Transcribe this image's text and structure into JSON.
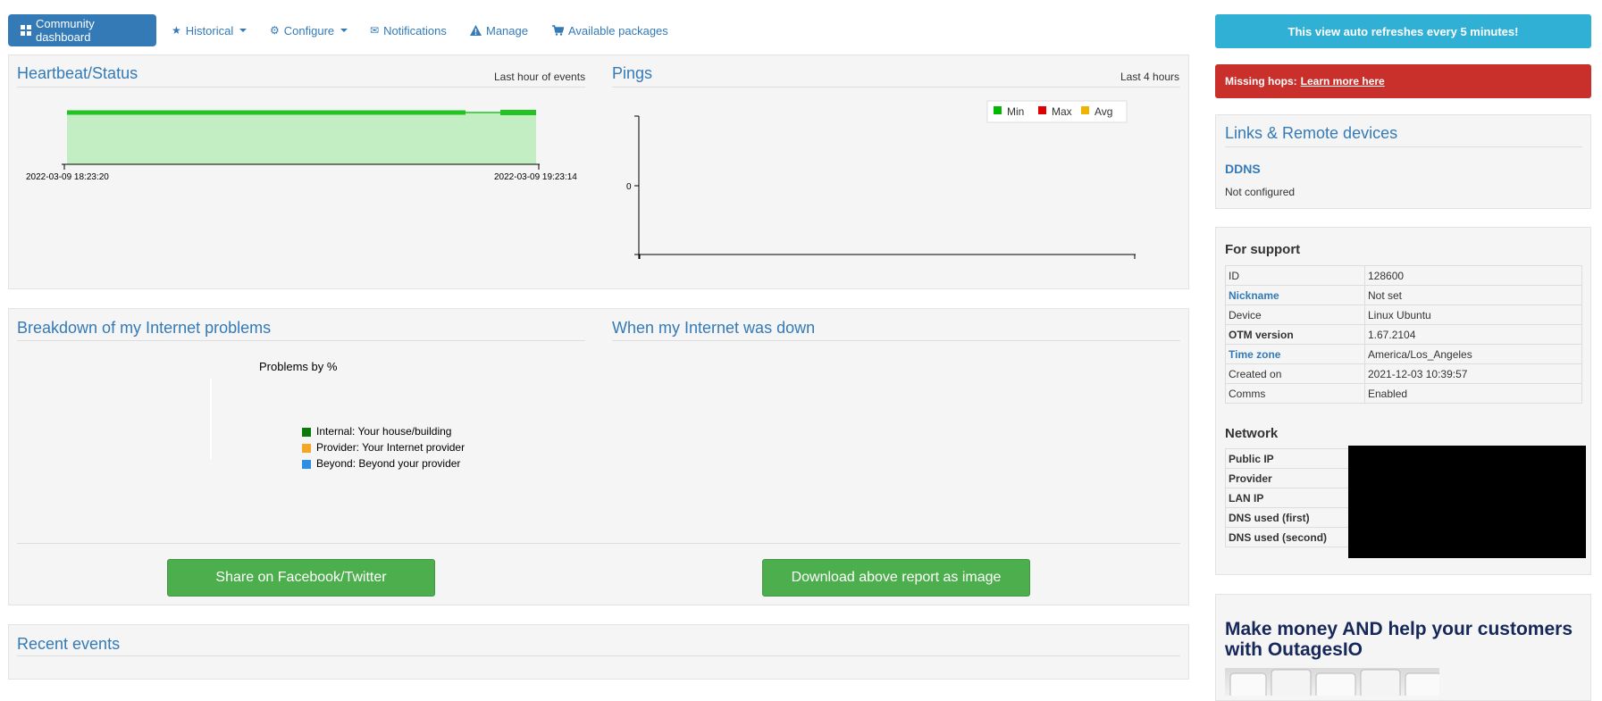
{
  "nav": {
    "items": [
      {
        "label": "Community dashboard",
        "icon": "dashboard-grid-icon",
        "active": true
      },
      {
        "label": "Historical",
        "icon": "star-icon",
        "dropdown": true
      },
      {
        "label": "Configure",
        "icon": "gear-icon",
        "dropdown": true
      },
      {
        "label": "Notifications",
        "icon": "envelope-icon"
      },
      {
        "label": "Manage",
        "icon": "warning-icon"
      },
      {
        "label": "Available packages",
        "icon": "cart-icon"
      }
    ]
  },
  "heartbeat": {
    "title": "Heartbeat/Status",
    "subtitle": "Last hour of events",
    "chart_data": {
      "type": "area",
      "x_start": "2022-03-09 18:23:20",
      "x_end": "2022-03-09 19:23:14",
      "tick_labels": [
        "2022-03-09 18:23:20",
        "2022-03-09 19:23:14"
      ],
      "color": "#22c322",
      "fill": "#c3edc3"
    }
  },
  "pings": {
    "title": "Pings",
    "subtitle": "Last 4 hours",
    "chart_data": {
      "type": "line",
      "y_ticks": [
        "0"
      ],
      "series": [
        {
          "name": "Min",
          "color": "#00b800",
          "values": []
        },
        {
          "name": "Max",
          "color": "#e00000",
          "values": []
        },
        {
          "name": "Avg",
          "color": "#f0b400",
          "values": []
        }
      ],
      "legend": "top-right"
    }
  },
  "breakdown": {
    "title": "Breakdown of my Internet problems",
    "chart_data": {
      "type": "pie",
      "title": "Problems by %",
      "legend": [
        {
          "name": "Internal: Your house/building",
          "color": "#0a7a0a"
        },
        {
          "name": "Provider: Your Internet provider",
          "color": "#f5a623"
        },
        {
          "name": "Beyond: Beyond your provider",
          "color": "#2b8fe6"
        }
      ],
      "values": []
    }
  },
  "down": {
    "title": "When my Internet was down"
  },
  "buttons": {
    "share": "Share on Facebook/Twitter",
    "download": "Download above report as image"
  },
  "recent": {
    "title": "Recent events"
  },
  "right": {
    "refresh": "This view auto refreshes every 5 minutes!",
    "missing_label": "Missing hops:",
    "missing_link": "Learn more here",
    "links_title": "Links & Remote devices",
    "ddns_title": "DDNS",
    "ddns_status": "Not configured",
    "support_title": "For support",
    "support_rows": [
      {
        "key": "ID",
        "value": "128600",
        "link": false
      },
      {
        "key": "Nickname",
        "value": "Not set",
        "link": true
      },
      {
        "key": "Device",
        "value": "Linux Ubuntu",
        "link": false
      },
      {
        "key": "OTM version",
        "value": "1.67.2104",
        "link": false,
        "bold": true
      },
      {
        "key": "Time zone",
        "value": "America/Los_Angeles",
        "link": true
      },
      {
        "key": "Created on",
        "value": "2021-12-03 10:39:57",
        "link": false
      },
      {
        "key": "Comms",
        "value": "Enabled",
        "link": false
      }
    ],
    "network_title": "Network",
    "network_rows": [
      {
        "key": "Public IP"
      },
      {
        "key": "Provider"
      },
      {
        "key": "LAN IP"
      },
      {
        "key": "DNS used (first)"
      },
      {
        "key": "DNS used (second)"
      }
    ],
    "promo_title": "Make money AND help your customers with OutagesIO"
  }
}
